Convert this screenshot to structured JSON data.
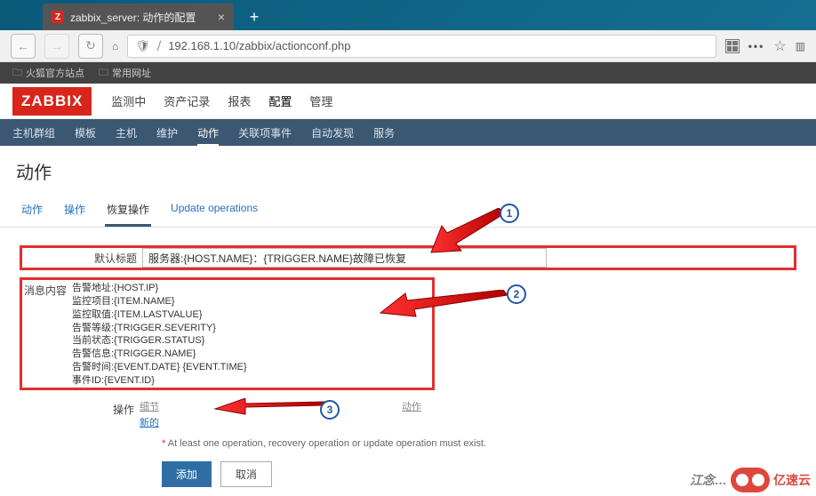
{
  "browser": {
    "tab_title": "zabbix_server: 动作的配置",
    "url": "192.168.1.10/zabbix/actionconf.php",
    "bookmarks": [
      "火狐官方站点",
      "常用网址"
    ]
  },
  "zabbix": {
    "logo": "ZABBIX",
    "main_nav": [
      "监测中",
      "资产记录",
      "报表",
      "配置",
      "管理"
    ],
    "main_nav_active": "配置",
    "sub_nav": [
      "主机群组",
      "模板",
      "主机",
      "维护",
      "动作",
      "关联项事件",
      "自动发现",
      "服务"
    ],
    "sub_nav_active": "动作",
    "page_title": "动作",
    "tabs": [
      "动作",
      "操作",
      "恢复操作",
      "Update operations"
    ],
    "tab_active": "恢复操作",
    "form": {
      "default_title_label": "默认标题",
      "default_title_value": "服务器:{HOST.NAME}：{TRIGGER.NAME}故障已恢复",
      "message_label": "消息内容",
      "message_value": "告警地址:{HOST.IP}\n监控项目:{ITEM.NAME}\n监控取值:{ITEM.LASTVALUE}\n告警等级:{TRIGGER.SEVERITY}\n当前状态:{TRIGGER.STATUS}\n告警信息:{TRIGGER.NAME}\n告警时间:{EVENT.DATE} {EVENT.TIME}\n事件ID:{EVENT.ID}",
      "operations_label": "操作",
      "ops_col_detail": "细节",
      "ops_col_action": "动作",
      "ops_new_link": "新的",
      "required_note": "At least one operation, recovery operation or update operation must exist.",
      "btn_add": "添加",
      "btn_cancel": "取消"
    }
  },
  "callouts": {
    "c1": "1",
    "c2": "2",
    "c3": "3"
  },
  "watermark": {
    "text": "江念…",
    "brand": "亿速云"
  }
}
